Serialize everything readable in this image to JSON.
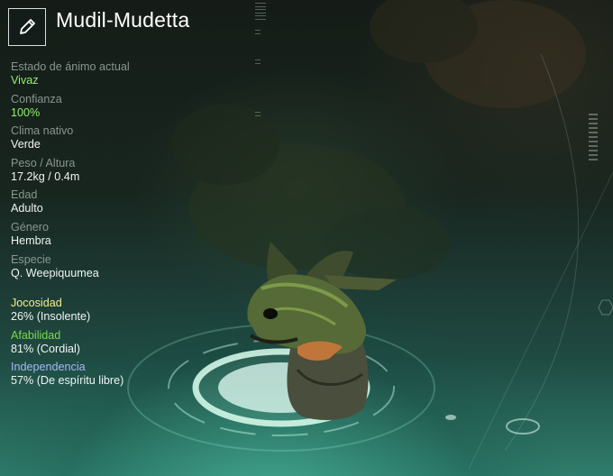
{
  "pet": {
    "name": "Mudil-Mudetta"
  },
  "icons": {
    "edit": "pencil-icon"
  },
  "colors": {
    "mood_value": "#8ff36e",
    "trust_value": "#8ff36e",
    "playfulness_label": "#f1ef8e",
    "friendliness_label": "#7bd84e",
    "independence_label": "#a8b7f2"
  },
  "stats": [
    {
      "label": "Estado de ánimo actual",
      "value": "Vivaz"
    },
    {
      "label": "Confianza",
      "value": "100%"
    },
    {
      "label": "Clima nativo",
      "value": "Verde"
    },
    {
      "label": "Peso / Altura",
      "value": "17.2kg / 0.4m"
    },
    {
      "label": "Edad",
      "value": "Adulto"
    },
    {
      "label": "Género",
      "value": "Hembra"
    },
    {
      "label": "Especie",
      "value": "Q. Weepiquumea"
    }
  ],
  "traits": [
    {
      "label": "Jocosidad",
      "value": "26% (Insolente)"
    },
    {
      "label": "Afabilidad",
      "value": "81% (Cordial)"
    },
    {
      "label": "Independencia",
      "value": "57% (De espíritu libre)"
    }
  ]
}
